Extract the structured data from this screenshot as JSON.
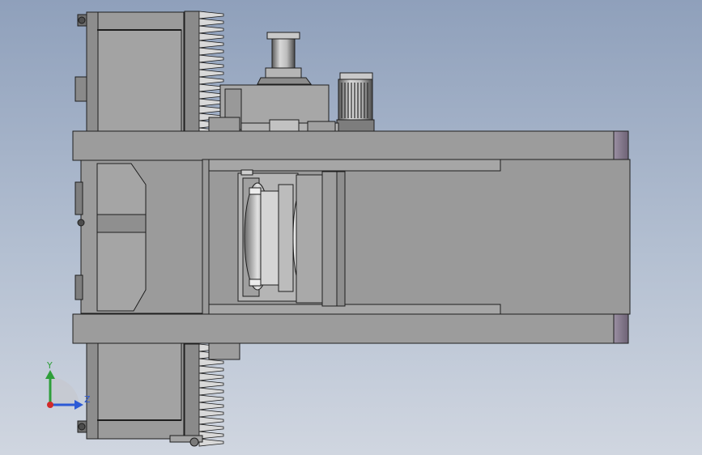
{
  "view": {
    "background_top": "#8fa0bb",
    "background_bottom": "#d0d6e0",
    "part_fill": "#9b9b9b",
    "part_fill_light": "#b8b8b8",
    "part_fill_dark": "#6f6f6f",
    "end_cap_fill": "#8a7f92",
    "edge_color": "#1e1e1e"
  },
  "triad": {
    "y_label": "Y",
    "z_label": "Z",
    "y_color": "#2e9e3a",
    "z_color": "#2c5ad6",
    "x_color": "#d12a2a"
  }
}
